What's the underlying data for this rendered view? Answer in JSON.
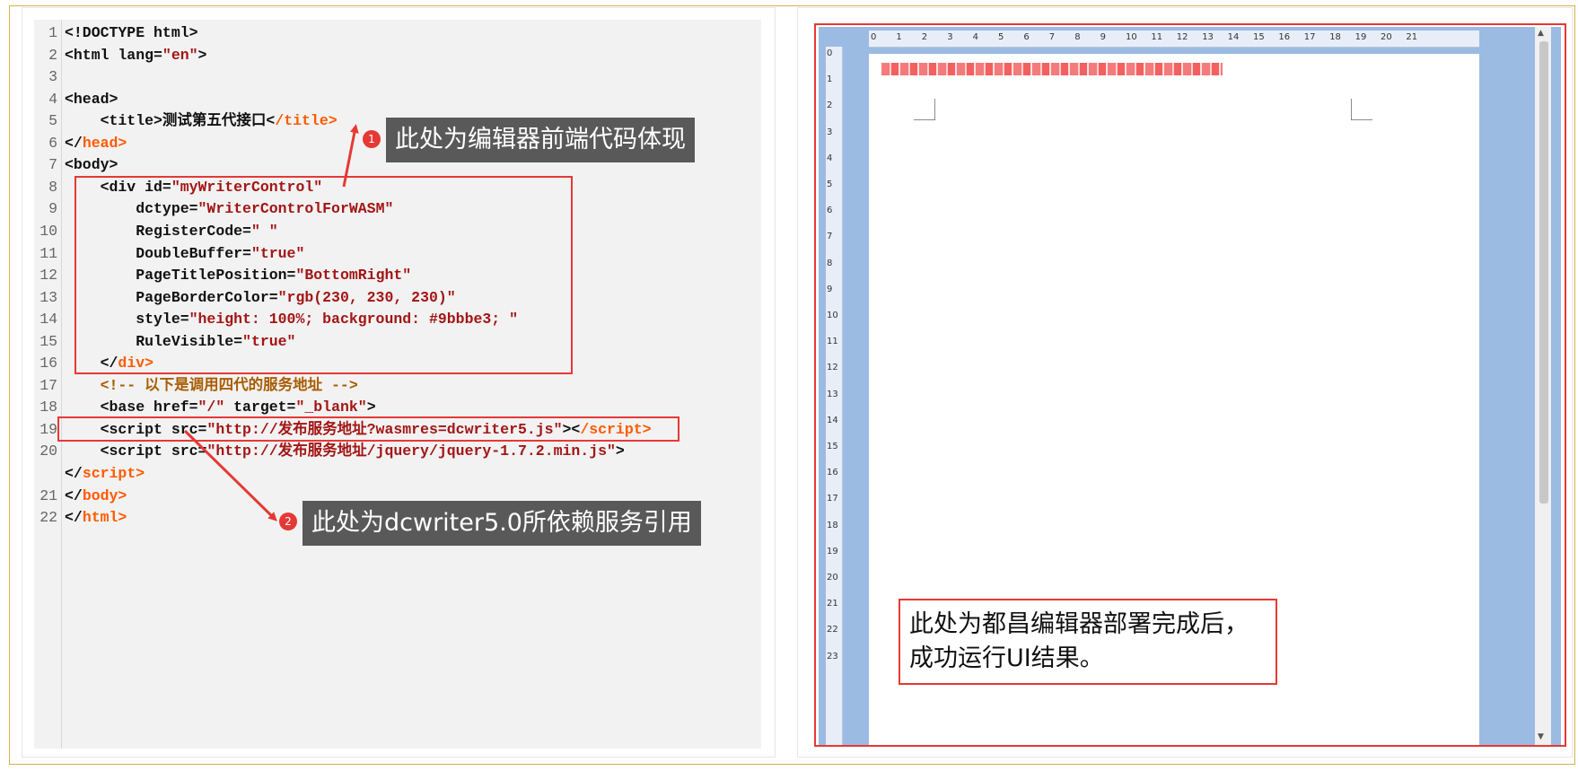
{
  "code": {
    "lines": [
      {
        "n": "1",
        "parts": [
          [
            "t",
            "<!DOCTYPE html>"
          ]
        ]
      },
      {
        "n": "2",
        "parts": [
          [
            "t",
            "<html lang="
          ],
          [
            "v",
            "\"en\""
          ],
          [
            "t",
            ">"
          ]
        ]
      },
      {
        "n": "3",
        "parts": []
      },
      {
        "n": "4",
        "parts": [
          [
            "t",
            "<head>"
          ]
        ]
      },
      {
        "n": "5",
        "parts": [
          [
            "t",
            "    <title>测试第五代接口<"
          ],
          [
            "c",
            "/title>"
          ]
        ]
      },
      {
        "n": "6",
        "parts": [
          [
            "t",
            "</"
          ],
          [
            "c",
            "head>"
          ]
        ]
      },
      {
        "n": "7",
        "parts": [
          [
            "t",
            "<body>"
          ]
        ]
      },
      {
        "n": "8",
        "parts": [
          [
            "t",
            "    <div id="
          ],
          [
            "v",
            "\"myWriterControl\""
          ]
        ]
      },
      {
        "n": "9",
        "parts": [
          [
            "t",
            "        dctype="
          ],
          [
            "v",
            "\"WriterControlForWASM\""
          ]
        ]
      },
      {
        "n": "10",
        "parts": [
          [
            "t",
            "        RegisterCode="
          ],
          [
            "v",
            "\" \""
          ]
        ]
      },
      {
        "n": "11",
        "parts": [
          [
            "t",
            "        DoubleBuffer="
          ],
          [
            "v",
            "\"true\""
          ]
        ]
      },
      {
        "n": "12",
        "parts": [
          [
            "t",
            "        PageTitlePosition="
          ],
          [
            "v",
            "\"BottomRight\""
          ]
        ]
      },
      {
        "n": "13",
        "parts": [
          [
            "t",
            "        PageBorderColor="
          ],
          [
            "v",
            "\"rgb(230, 230, 230)\""
          ]
        ]
      },
      {
        "n": "14",
        "parts": [
          [
            "t",
            "        style="
          ],
          [
            "v",
            "\"height: 100%; background: #9bbbe3; \""
          ]
        ]
      },
      {
        "n": "15",
        "parts": [
          [
            "t",
            "        RuleVisible="
          ],
          [
            "v",
            "\"true\""
          ]
        ]
      },
      {
        "n": "16",
        "parts": [
          [
            "t",
            "    </"
          ],
          [
            "c",
            "div>"
          ]
        ]
      },
      {
        "n": "17",
        "parts": [
          [
            "m",
            "    <!-- 以下是调用四代的服务地址 -->"
          ]
        ]
      },
      {
        "n": "18",
        "parts": [
          [
            "t",
            "    <base href="
          ],
          [
            "v",
            "\"/\""
          ],
          [
            "t",
            " target="
          ],
          [
            "v",
            "\"_blank\""
          ],
          [
            "t",
            ">"
          ]
        ]
      },
      {
        "n": "19",
        "parts": [
          [
            "t",
            "    <script src="
          ],
          [
            "v",
            "\"http://发布服务地址?wasmres=dcwriter5.js\""
          ],
          [
            "t",
            "><"
          ],
          [
            "c",
            "/script>"
          ]
        ]
      },
      {
        "n": "20",
        "parts": [
          [
            "t",
            "    <script src="
          ],
          [
            "v",
            "\"http://发布服务地址/jquery/jquery-1.7.2.min.js\""
          ],
          [
            "t",
            ">"
          ]
        ]
      },
      {
        "n": "",
        "parts": [
          [
            "t",
            "</"
          ],
          [
            "c",
            "script>"
          ]
        ]
      },
      {
        "n": "21",
        "parts": [
          [
            "t",
            "</"
          ],
          [
            "c",
            "body>"
          ]
        ]
      },
      {
        "n": "22",
        "parts": [
          [
            "t",
            "</"
          ],
          [
            "c",
            "html>"
          ]
        ]
      }
    ]
  },
  "callouts": {
    "one": {
      "badge": "1",
      "text": "此处为编辑器前端代码体现"
    },
    "two": {
      "badge": "2",
      "text": "此处为dcwriter5.0所依赖服务引用"
    }
  },
  "preview": {
    "note_line1": "此处为都昌编辑器部署完成后，",
    "note_line2": "成功运行UI结果。",
    "ruler_h": [
      "0",
      "1",
      "2",
      "3",
      "4",
      "5",
      "6",
      "7",
      "8",
      "9",
      "10",
      "11",
      "12",
      "13",
      "14",
      "15",
      "16",
      "17",
      "18",
      "19",
      "20",
      "21"
    ],
    "ruler_v": [
      "0",
      "1",
      "2",
      "3",
      "4",
      "5",
      "6",
      "7",
      "8",
      "9",
      "10",
      "11",
      "12",
      "13",
      "14",
      "15",
      "16",
      "17",
      "18",
      "19",
      "20",
      "21",
      "22",
      "23"
    ],
    "background_color": "#9bbbe3"
  },
  "colors": {
    "accent": "#e53935",
    "callout_bg": "#595959",
    "frame": "#d6b24a"
  }
}
